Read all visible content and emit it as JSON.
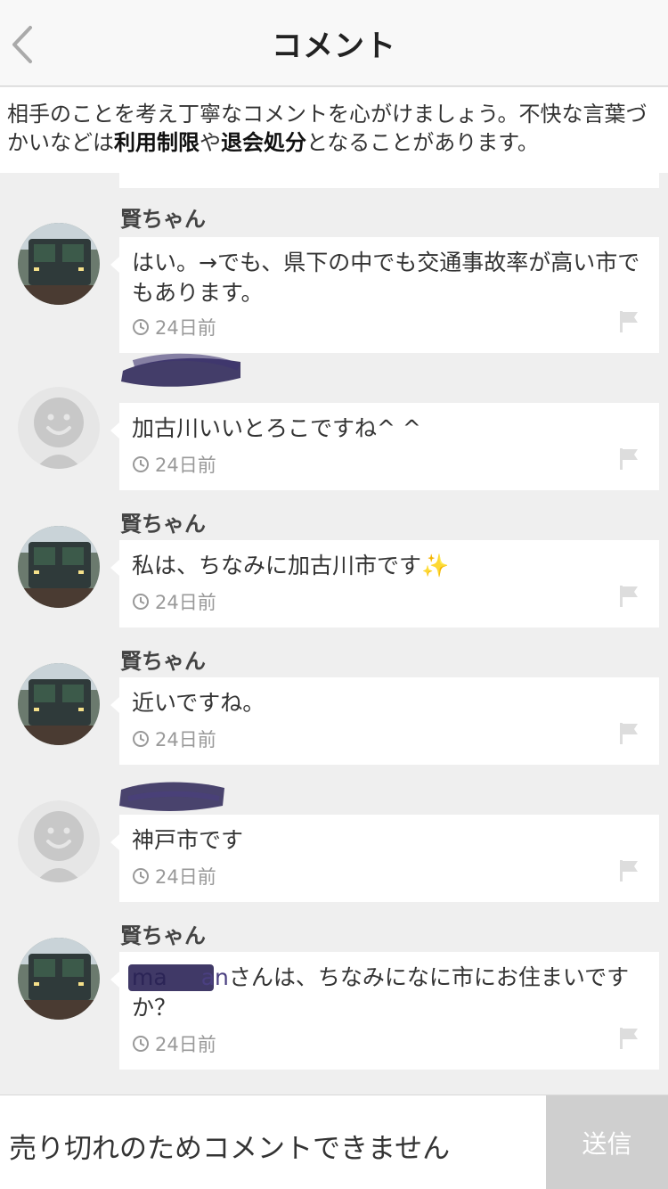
{
  "header": {
    "title": "コメント",
    "back_icon": "chevron-left-icon"
  },
  "notice": {
    "text_1": "相手のことを考え丁寧なコメントを心がけましょう。不快な言葉づかいなどは",
    "bold_1": "利用制限",
    "text_2": "や",
    "bold_2": "退会処分",
    "text_3": "となることがあります。"
  },
  "comments": [
    {
      "user": "賢ちゃん",
      "message": "はい。→でも、県下の中でも交通事故率が高い市でもあります。",
      "time": "24日前"
    },
    {
      "user": "",
      "message": "加古川いいとろこですね^ ^",
      "time": "24日前"
    },
    {
      "user": "賢ちゃん",
      "message": "私は、ちなみに加古川市です",
      "emoji": "✨",
      "time": "24日前"
    },
    {
      "user": "賢ちゃん",
      "message": "近いですね。",
      "time": "24日前"
    },
    {
      "user": "",
      "message": "神戸市です",
      "time": "24日前"
    },
    {
      "user": "賢ちゃん",
      "message_prefix": "ma",
      "message_redacted_tail": "an",
      "message": "さんは、ちなみになに市にお住まいですか？",
      "time": "24日前"
    }
  ],
  "footer": {
    "placeholder": "売り切れのためコメントできません",
    "send_label": "送信"
  },
  "colors": {
    "background": "#efefef",
    "card": "#ffffff",
    "send_disabled": "#cfcfcf",
    "redaction": "#2b2456"
  }
}
